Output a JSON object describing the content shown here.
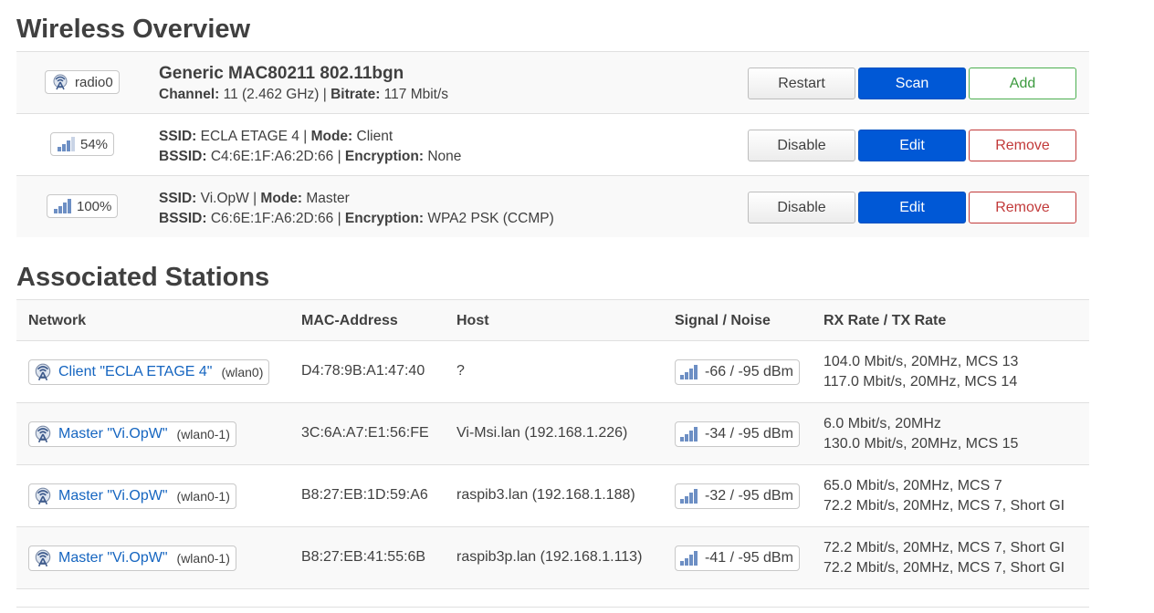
{
  "wireless": {
    "title": "Wireless Overview",
    "radio": {
      "badge": "radio0",
      "name": "Generic MAC80211 802.11bgn",
      "channel_label": "Channel:",
      "channel_value": "11 (2.462 GHz)",
      "bitrate_label": "Bitrate:",
      "bitrate_value": "117 Mbit/s",
      "buttons": {
        "restart": "Restart",
        "scan": "Scan",
        "add": "Add"
      }
    },
    "networks": [
      {
        "signal": "54%",
        "ssid_label": "SSID:",
        "ssid": "ECLA ETAGE 4",
        "mode_label": "Mode:",
        "mode": "Client",
        "bssid_label": "BSSID:",
        "bssid": "C4:6E:1F:A6:2D:66",
        "enc_label": "Encryption:",
        "enc": "None",
        "buttons": {
          "disable": "Disable",
          "edit": "Edit",
          "remove": "Remove"
        }
      },
      {
        "signal": "100%",
        "ssid_label": "SSID:",
        "ssid": "Vi.OpW",
        "mode_label": "Mode:",
        "mode": "Master",
        "bssid_label": "BSSID:",
        "bssid": "C6:6E:1F:A6:2D:66",
        "enc_label": "Encryption:",
        "enc": "WPA2 PSK (CCMP)",
        "buttons": {
          "disable": "Disable",
          "edit": "Edit",
          "remove": "Remove"
        }
      }
    ]
  },
  "stations": {
    "title": "Associated Stations",
    "columns": [
      "Network",
      "MAC-Address",
      "Host",
      "Signal / Noise",
      "RX Rate / TX Rate"
    ],
    "rows": [
      {
        "network": "Client \"ECLA ETAGE 4\"",
        "iface": "(wlan0)",
        "mac": "D4:78:9B:A1:47:40",
        "host": "?",
        "signal": "-66 / -95 dBm",
        "rx": "104.0 Mbit/s, 20MHz, MCS 13",
        "tx": "117.0 Mbit/s, 20MHz, MCS 14"
      },
      {
        "network": "Master \"Vi.OpW\"",
        "iface": "(wlan0-1)",
        "mac": "3C:6A:A7:E1:56:FE",
        "host": "Vi-Msi.lan (192.168.1.226)",
        "signal": "-34 / -95 dBm",
        "rx": "6.0 Mbit/s, 20MHz",
        "tx": "130.0 Mbit/s, 20MHz, MCS 15"
      },
      {
        "network": "Master \"Vi.OpW\"",
        "iface": "(wlan0-1)",
        "mac": "B8:27:EB:1D:59:A6",
        "host": "raspib3.lan (192.168.1.188)",
        "signal": "-32 / -95 dBm",
        "rx": "65.0 Mbit/s, 20MHz, MCS 7",
        "tx": "72.2 Mbit/s, 20MHz, MCS 7, Short GI"
      },
      {
        "network": "Master \"Vi.OpW\"",
        "iface": "(wlan0-1)",
        "mac": "B8:27:EB:41:55:6B",
        "host": "raspib3p.lan (192.168.1.113)",
        "signal": "-41 / -95 dBm",
        "rx": "72.2 Mbit/s, 20MHz, MCS 7, Short GI",
        "tx": "72.2 Mbit/s, 20MHz, MCS 7, Short GI"
      }
    ]
  },
  "icons": {
    "radio": "wifi-antenna-icon",
    "signal": "signal-bars-icon"
  },
  "colors": {
    "primary": "#0058d6",
    "link": "#1565c0",
    "positive": "#3c9a3f",
    "negative": "#c23a3a"
  }
}
